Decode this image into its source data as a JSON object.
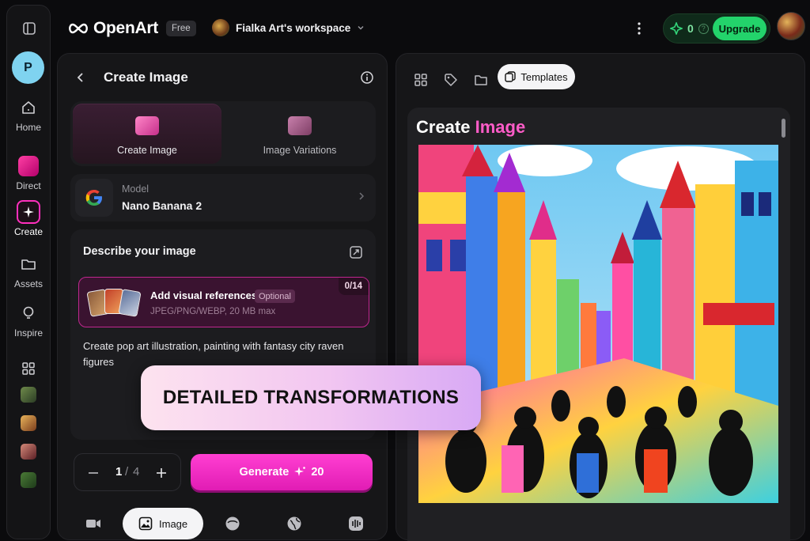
{
  "brand": {
    "name": "OpenArt",
    "plan": "Free"
  },
  "workspace": {
    "name": "Fialka Art's workspace"
  },
  "credits": {
    "count": "0",
    "upgrade_label": "Upgrade"
  },
  "rail": {
    "avatar_letter": "P",
    "items": [
      {
        "label": "Home"
      },
      {
        "label": "Direct"
      },
      {
        "label": "Create"
      },
      {
        "label": "Assets"
      },
      {
        "label": "Inspire"
      }
    ]
  },
  "panel": {
    "title": "Create Image",
    "modes": [
      {
        "label": "Create Image",
        "active": true
      },
      {
        "label": "Image Variations",
        "active": false
      }
    ],
    "model": {
      "caption": "Model",
      "name": "Nano Banana 2"
    },
    "prompt": {
      "label": "Describe your image",
      "refs_title": "Add visual references",
      "refs_optional": "Optional",
      "refs_formats": "JPEG/PNG/WEBP, 20 MB max",
      "refs_count": "0/14",
      "text": "Create pop art illustration, painting with fantasy city raven figures"
    },
    "counter": {
      "current": "1",
      "separator": "/",
      "max": "4"
    },
    "generate": {
      "label": "Generate",
      "cost": "20"
    },
    "bottom_tabs": [
      {
        "icon": "video-icon"
      },
      {
        "icon": "image-icon",
        "label": "Image",
        "active": true
      },
      {
        "icon": "face-icon"
      },
      {
        "icon": "globe-icon"
      },
      {
        "icon": "audio-icon"
      }
    ]
  },
  "overlay": {
    "text": "DETAILED TRANSFORMATIONS"
  },
  "right": {
    "templates_label": "Templates",
    "preview": {
      "title_white": "Create ",
      "title_accent": "Image"
    }
  },
  "colors": {
    "accent_pink": "#ff2fbd",
    "upgrade_green": "#23d36b",
    "bg": "#0b0b0d"
  }
}
